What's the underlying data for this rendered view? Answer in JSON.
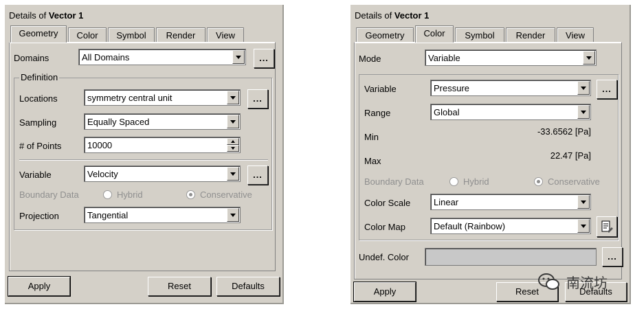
{
  "left": {
    "title_prefix": "Details of ",
    "title_name": "Vector 1",
    "tabs": [
      "Geometry",
      "Color",
      "Symbol",
      "Render",
      "View"
    ],
    "domains_label": "Domains",
    "domains_value": "All Domains",
    "definition_label": "Definition",
    "locations_label": "Locations",
    "locations_value": "symmetry central unit",
    "sampling_label": "Sampling",
    "sampling_value": "Equally Spaced",
    "points_label": "# of Points",
    "points_value": "10000",
    "variable_label": "Variable",
    "variable_value": "Velocity",
    "boundary_label": "Boundary Data",
    "hybrid_label": "Hybrid",
    "conservative_label": "Conservative",
    "projection_label": "Projection",
    "projection_value": "Tangential",
    "dots": "...",
    "apply": "Apply",
    "reset": "Reset",
    "defaults": "Defaults"
  },
  "right": {
    "title_prefix": "Details of ",
    "title_name": "Vector 1",
    "tabs": [
      "Geometry",
      "Color",
      "Symbol",
      "Render",
      "View"
    ],
    "mode_label": "Mode",
    "mode_value": "Variable",
    "variable_label": "Variable",
    "variable_value": "Pressure",
    "range_label": "Range",
    "range_value": "Global",
    "min_label": "Min",
    "min_value": "-33.6562 [Pa]",
    "max_label": "Max",
    "max_value": "22.47 [Pa]",
    "boundary_label": "Boundary Data",
    "hybrid_label": "Hybrid",
    "conservative_label": "Conservative",
    "colorscale_label": "Color Scale",
    "colorscale_value": "Linear",
    "colormap_label": "Color Map",
    "colormap_value": "Default (Rainbow)",
    "undef_label": "Undef. Color",
    "undef_color": "#c8c8c8",
    "dots": "...",
    "apply": "Apply",
    "reset": "Reset",
    "defaults": "Defaults"
  },
  "watermark": "南流坊"
}
